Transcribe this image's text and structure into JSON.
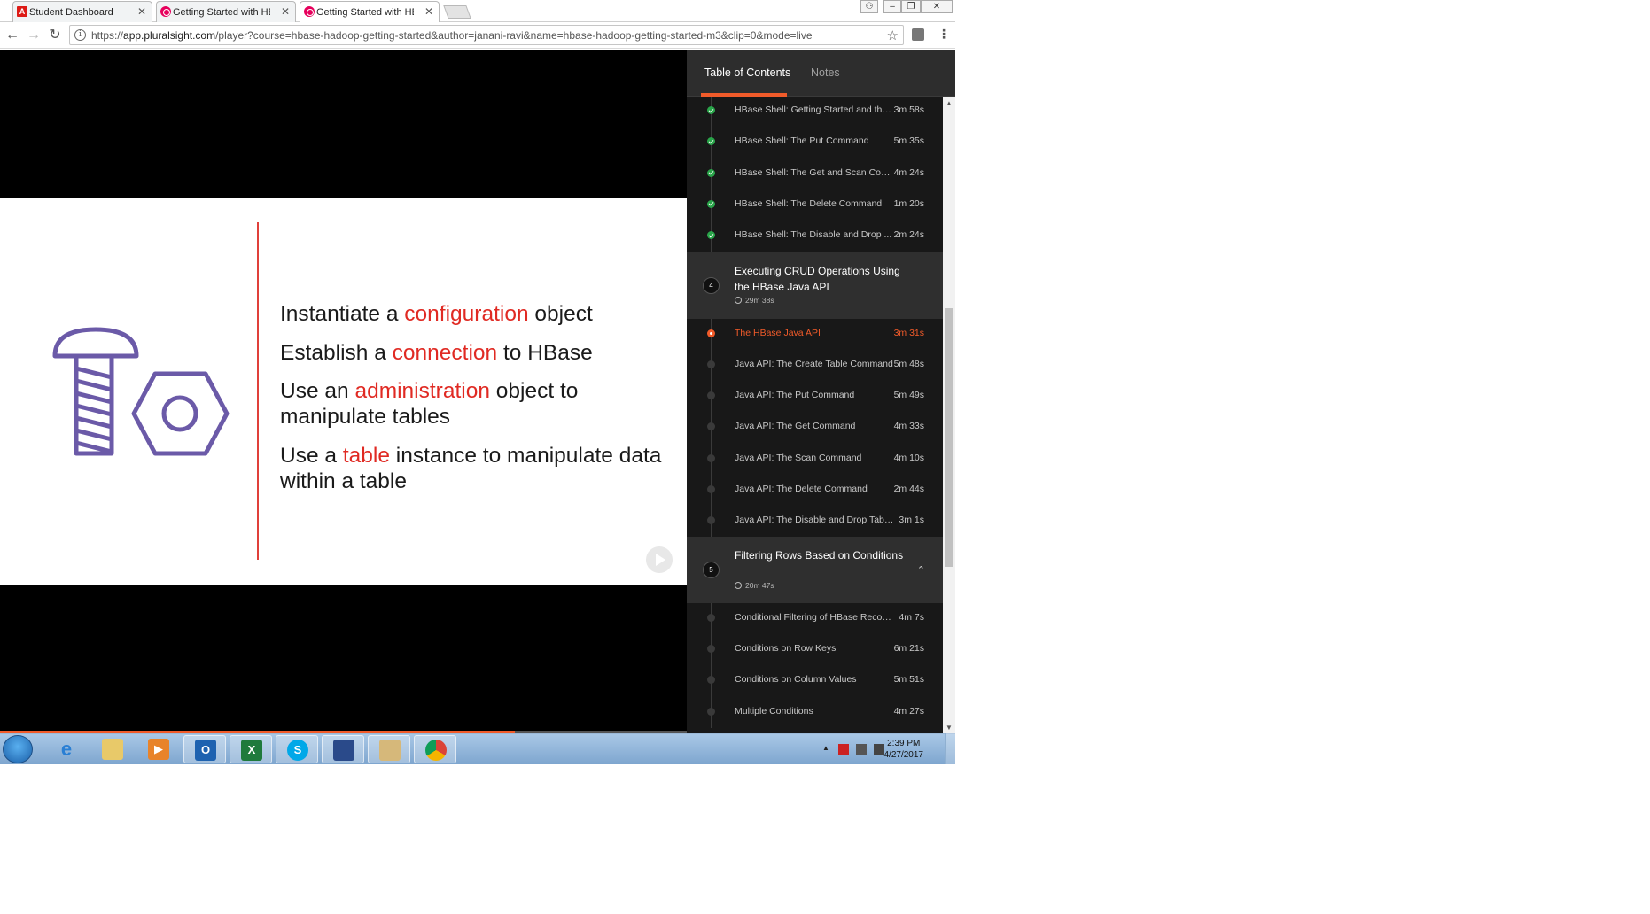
{
  "browser": {
    "tabs": [
      {
        "label": "Student Dashboard",
        "active": false
      },
      {
        "label": "Getting Started with HBase",
        "active": false
      },
      {
        "label": "Getting Started with HBase",
        "active": true
      }
    ],
    "url_prefix": "https://",
    "url_host": "app.pluralsight.com",
    "url_path": "/player?course=hbase-hadoop-getting-started&author=janani-ravi&name=hbase-hadoop-getting-started-m3&clip=0&mode=live"
  },
  "slide": {
    "bullets": [
      {
        "pre": "Instantiate a ",
        "hl": "configuration",
        "post": " object"
      },
      {
        "pre": "Establish a ",
        "hl": "connection",
        "post": " to HBase"
      },
      {
        "pre": "Use an ",
        "hl": "administration",
        "post": " object to manipulate tables"
      },
      {
        "pre": "Use a ",
        "hl": "table",
        "post": " instance to manipulate data within a table"
      }
    ],
    "accent_color": "#e02a23",
    "icon_color": "#6b5aa8"
  },
  "player": {
    "progress_fraction": 0.75
  },
  "sidebar": {
    "tab_toc": "Table of Contents",
    "tab_notes": "Notes",
    "section_top_clips": [
      {
        "title": "HBase Shell: Getting Started and the...",
        "duration": "3m 58s",
        "status": "done"
      },
      {
        "title": "HBase Shell: The Put Command",
        "duration": "5m 35s",
        "status": "done"
      },
      {
        "title": "HBase Shell: The Get and Scan Com...",
        "duration": "4m 24s",
        "status": "done"
      },
      {
        "title": "HBase Shell: The Delete Command",
        "duration": "1m 20s",
        "status": "done"
      },
      {
        "title": "HBase Shell: The Disable and Drop ...",
        "duration": "2m 24s",
        "status": "done"
      }
    ],
    "module4": {
      "number": "4",
      "title": "Executing CRUD Operations Using the HBase Java API",
      "duration": "29m 38s"
    },
    "module4_clips": [
      {
        "title": "The HBase Java API",
        "duration": "3m 31s",
        "status": "current"
      },
      {
        "title": "Java API: The Create Table Command",
        "duration": "5m 48s",
        "status": "todo"
      },
      {
        "title": "Java API: The Put Command",
        "duration": "5m 49s",
        "status": "todo"
      },
      {
        "title": "Java API: The Get Command",
        "duration": "4m 33s",
        "status": "todo"
      },
      {
        "title": "Java API: The Scan Command",
        "duration": "4m 10s",
        "status": "todo"
      },
      {
        "title": "Java API: The Delete Command",
        "duration": "2m 44s",
        "status": "todo"
      },
      {
        "title": "Java API: The Disable and Drop Table...",
        "duration": "3m 1s",
        "status": "todo"
      }
    ],
    "module5": {
      "number": "5",
      "title": "Filtering Rows Based on Conditions",
      "duration": "20m 47s"
    },
    "module5_clips": [
      {
        "title": "Conditional Filtering of HBase Records",
        "duration": "4m 7s",
        "status": "todo"
      },
      {
        "title": "Conditions on Row Keys",
        "duration": "6m 21s",
        "status": "todo"
      },
      {
        "title": "Conditions on Column Values",
        "duration": "5m 51s",
        "status": "todo"
      },
      {
        "title": "Multiple Conditions",
        "duration": "4m 27s",
        "status": "todo"
      }
    ],
    "accent_color": "#f15b2a",
    "done_color": "#2aa54a"
  },
  "taskbar": {
    "apps": [
      "internet-explorer-icon",
      "file-explorer-icon",
      "media-player-icon",
      "outlook-icon",
      "excel-icon",
      "skype-icon",
      "virtualbox-icon",
      "paint-icon",
      "chrome-icon"
    ],
    "time": "2:39 PM",
    "date": "4/27/2017"
  }
}
